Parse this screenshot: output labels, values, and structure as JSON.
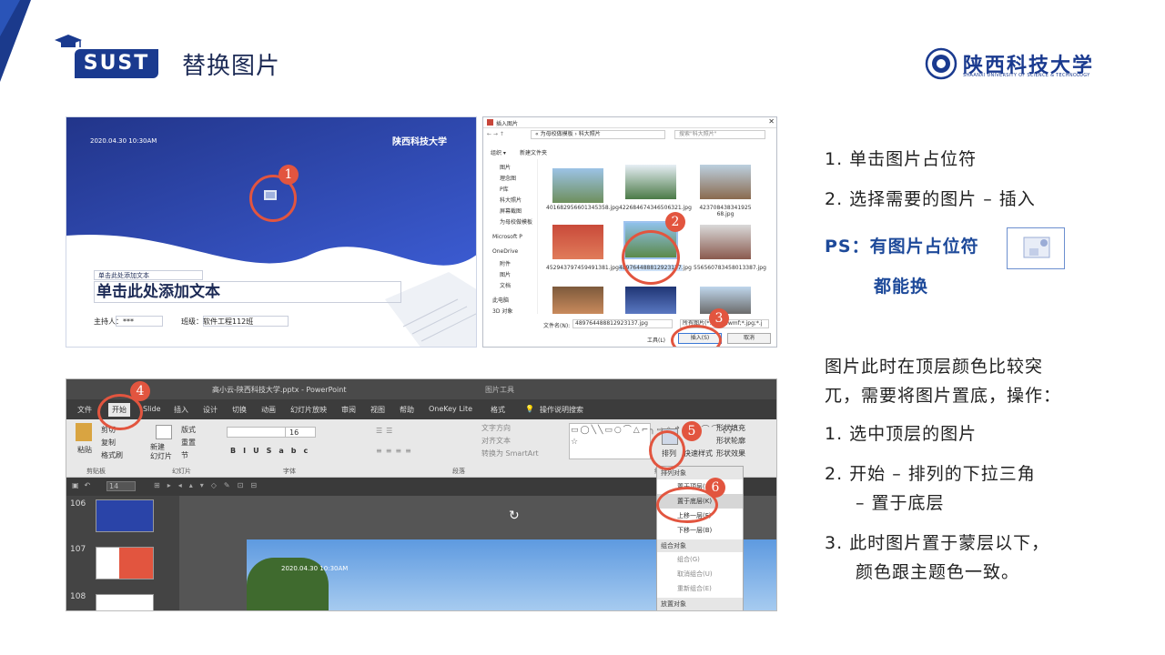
{
  "header": {
    "badge": "SUST",
    "title": "替换图片",
    "uni_name": "陕西科技大学",
    "uni_en": "SHAANXI UNIVERSITY OF SCIENCE & TECHNOLOGY"
  },
  "panel_slide": {
    "datetime": "2020.04.30   10:30AM",
    "logo_text": "陕西科技大学",
    "subtitle_ph": "单击此处添加文本",
    "title_ph": "单击此处添加文本",
    "host_label": "主持人：***",
    "class_label": "班级：软件工程112班"
  },
  "panel_dialog": {
    "window_title": "插入图片",
    "breadcrumb": "« 为母校做模板 › 科大照片",
    "search_placeholder": "搜索\"科大照片\"",
    "organize": "组织 ▾",
    "new_folder": "新建文件夹",
    "sidebar": [
      "图片",
      "理念图",
      "P库",
      "科大照片",
      "屏幕截图",
      "为母校做模板",
      "Microsoft P",
      "OneDrive",
      "附件",
      "图片",
      "文档",
      "此电脑",
      "3D 对象"
    ],
    "files": [
      "401682956601345358.jpg",
      "422684674346506321.jpg",
      "423708438341925 68.jpg",
      "452943797459491381.jpg",
      "489764488812923137.jpg",
      "556560783458013387.jpg"
    ],
    "filename_label": "文件名(N):",
    "filename_value": "489764488812923137.jpg",
    "filter_value": "所有图片(*.emf;*.wmf;*.jpg;*.j",
    "tools": "工具(L)",
    "insert": "插入(S)",
    "cancel": "取消"
  },
  "panel_ppt": {
    "title": "高小云-陕西科技大学.pptx  -  PowerPoint",
    "picture_tools": "图片工具",
    "tabs": [
      "文件",
      "开始",
      "Slide",
      "插入",
      "设计",
      "切换",
      "动画",
      "幻灯片放映",
      "审阅",
      "视图",
      "帮助",
      "OneKey Lite",
      "格式"
    ],
    "tell_me": "操作说明搜索",
    "ribbon": {
      "paste": "粘贴",
      "cut": "剪切",
      "copy": "复制",
      "format_painter": "格式刷",
      "new_slide": "新建\n幻灯片",
      "layout": "版式",
      "reset": "重置",
      "section": "节",
      "font_size": "16",
      "text_direction": "文字方向",
      "align_text": "对齐文本",
      "smartart": "转换为 SmartArt",
      "arrange": "排列",
      "quick_styles": "快速样式",
      "shape_fill": "形状填充",
      "shape_outline": "形状轮廓",
      "shape_effects": "形状效果"
    },
    "groups": [
      "剪贴板",
      "幻灯片",
      "字体",
      "段落",
      "绘图"
    ],
    "zoom": "14",
    "slide_numbers": [
      "106",
      "107",
      "108"
    ],
    "canvas_datetime": "2020.04.30   10:30AM",
    "menu": {
      "h1": "排列对象",
      "i1": "置于顶层(R)",
      "i2": "置于底层(K)",
      "i3": "上移一层(F)",
      "i4": "下移一层(B)",
      "h2": "组合对象",
      "i5": "组合(G)",
      "i6": "取消组合(U)",
      "i7": "重新组合(E)",
      "h3": "放置对象"
    }
  },
  "badges": [
    "1",
    "2",
    "3",
    "4",
    "5",
    "6"
  ],
  "instructions": {
    "s1": "1.  单击图片占位符",
    "s2": "2.  选择需要的图片 – 插入",
    "ps1": "PS：有图片占位符",
    "ps2": "都能换",
    "p1": "图片此时在顶层颜色比较突",
    "p2": "兀，需要将图片置底，操作：",
    "t1": "1.  选中顶层的图片",
    "t2a": "2.  开始 – 排列的下拉三角",
    "t2b": "– 置于底层",
    "t3a": "3.  此时图片置于蒙层以下，",
    "t3b": "颜色跟主题色一致。"
  },
  "colors": {
    "brand": "#1a3a8f",
    "accent": "#e2553f"
  }
}
